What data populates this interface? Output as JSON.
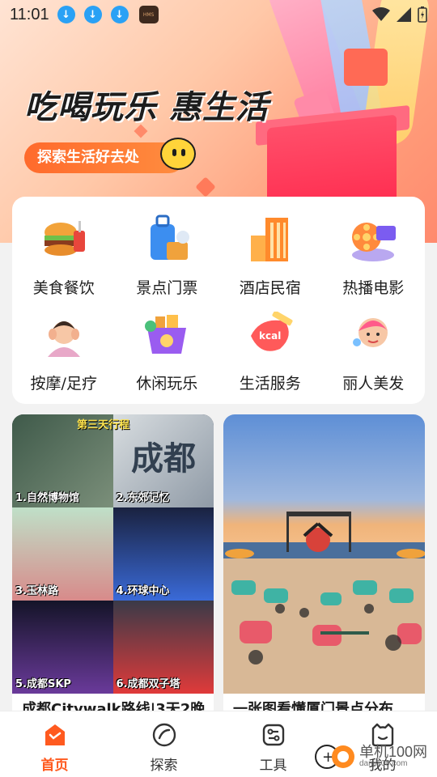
{
  "statusbar": {
    "time": "11:01",
    "badge": "HMS"
  },
  "hero": {
    "title": "吃喝玩乐 惠生活",
    "cta": "探索生活好去处",
    "colors": {
      "accent": "#ff6a2c",
      "gift": "#ff2d50"
    }
  },
  "categories": [
    {
      "label": "美食餐饮",
      "icon": "burger-drink-icon"
    },
    {
      "label": "景点门票",
      "icon": "luggage-icon"
    },
    {
      "label": "酒店民宿",
      "icon": "hotel-building-icon"
    },
    {
      "label": "热播电影",
      "icon": "film-reel-icon"
    },
    {
      "label": "按摩/足疗",
      "icon": "massage-icon"
    },
    {
      "label": "休闲玩乐",
      "icon": "shopping-basket-icon"
    },
    {
      "label": "生活服务",
      "icon": "kcal-tape-icon"
    },
    {
      "label": "丽人美发",
      "icon": "beauty-face-icon"
    }
  ],
  "feed": [
    {
      "title": "成都Citywalk路线|3天2晚",
      "image": {
        "banner": "第三天行程",
        "city": "成都",
        "stops": [
          "1.自然博物馆",
          "2.东郊记忆",
          "3.玉林路",
          "4.环球中心",
          "5.成都SKP",
          "6.成都双子塔"
        ]
      }
    },
    {
      "title": "一张图看懂厦门景点分布"
    }
  ],
  "tabs": [
    {
      "label": "首页",
      "icon": "home-icon",
      "active": true
    },
    {
      "label": "探索",
      "icon": "compass-icon",
      "active": false
    },
    {
      "label": "工具",
      "icon": "tools-icon",
      "active": false
    },
    {
      "label": "我的",
      "icon": "profile-icon",
      "active": false
    }
  ],
  "watermark": {
    "text": "单机100网",
    "sub": "danji100.com"
  }
}
